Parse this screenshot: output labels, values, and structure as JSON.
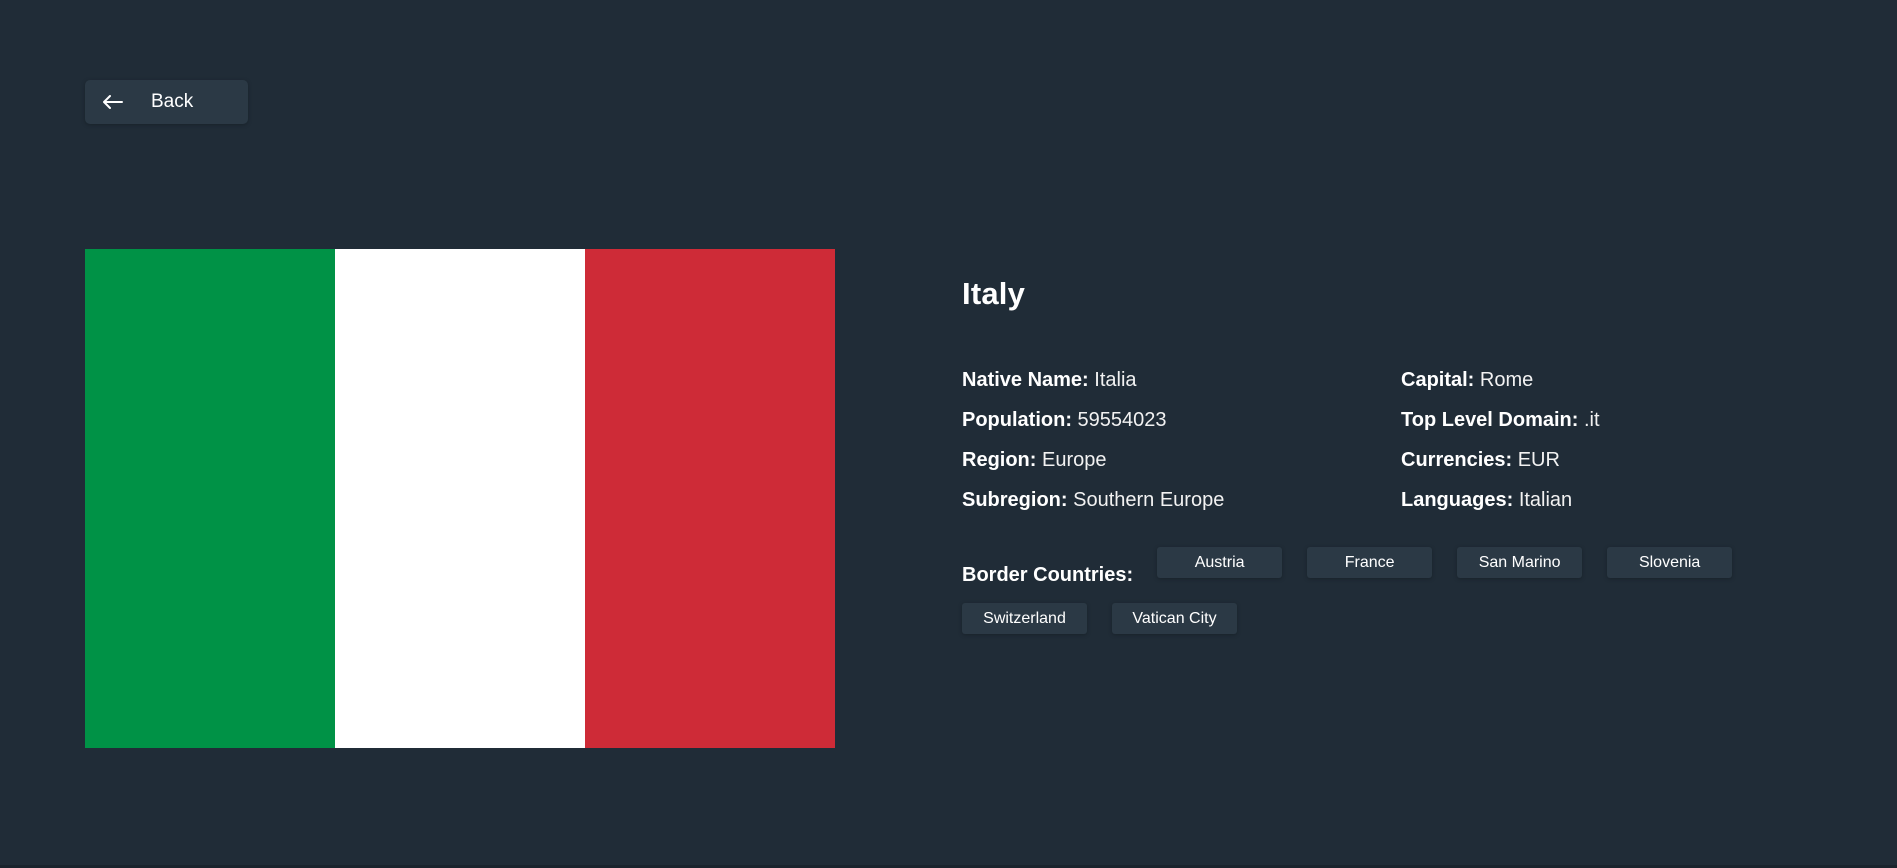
{
  "back_button": {
    "label": "Back",
    "icon": "arrow-left-icon"
  },
  "country": {
    "name": "Italy",
    "flag": {
      "colors": [
        "#009246",
        "#ffffff",
        "#ce2b37"
      ]
    },
    "details_left": [
      {
        "key": "Native Name:",
        "value": "Italia"
      },
      {
        "key": "Population:",
        "value": "59554023"
      },
      {
        "key": "Region:",
        "value": "Europe"
      },
      {
        "key": "Subregion:",
        "value": "Southern Europe"
      }
    ],
    "details_right": [
      {
        "key": "Capital:",
        "value": "Rome"
      },
      {
        "key": "Top Level Domain:",
        "value": ".it"
      },
      {
        "key": "Currencies:",
        "value": "EUR"
      },
      {
        "key": "Languages:",
        "value": "Italian"
      }
    ],
    "border_label": "Border Countries:",
    "borders": [
      "Austria",
      "France",
      "San Marino",
      "Slovenia",
      "Switzerland",
      "Vatican City"
    ]
  },
  "colors": {
    "background": "#202c37",
    "element": "#2b3945",
    "text": "#ffffff"
  }
}
